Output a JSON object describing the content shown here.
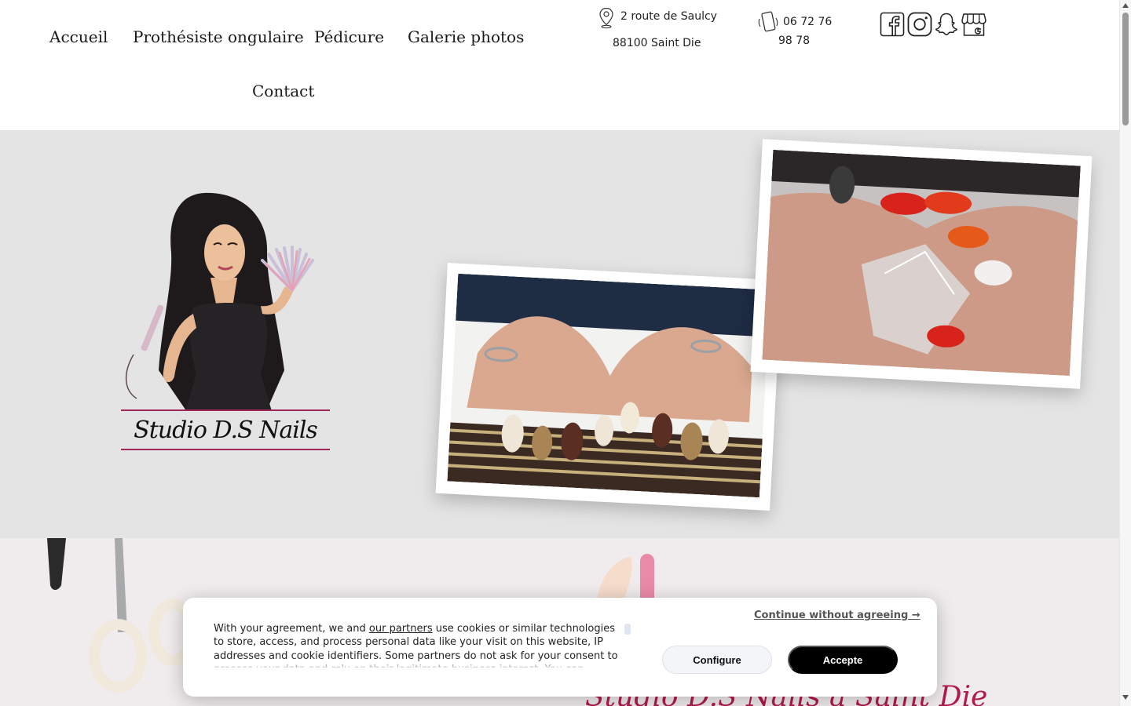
{
  "nav": {
    "items": [
      {
        "label": "Accueil"
      },
      {
        "label": "Prothésiste ongulaire"
      },
      {
        "label": "Pédicure"
      },
      {
        "label": "Galerie photos"
      },
      {
        "label": "Contact"
      }
    ]
  },
  "contact": {
    "address_line1": "2 route de Saulcy",
    "address_line2": "88100 Saint Die",
    "phone_line1": "06 72 76",
    "phone_line2": "98 78",
    "address_icon": "map-pin-icon",
    "phone_icon": "phone-icon"
  },
  "social": {
    "icons": [
      "facebook-icon",
      "instagram-icon",
      "snapchat-icon",
      "google-business-icon"
    ]
  },
  "hero": {
    "logo_text": "Studio D.S Nails",
    "background": "#e4e4e4"
  },
  "lower": {
    "title": "Studio D.S Nails à Saint Die"
  },
  "cookie": {
    "text_before_link": "With your agreement, we and ",
    "link_text": "our partners",
    "text_after_link": " use cookies or similar technologies to store, access, and process personal data like your visit on this website, IP addresses and cookie identifiers. Some partners do not ask for your consent to process your data and rely on their legitimate business interest. You can",
    "continue_label": "Continue without agreeing →",
    "configure_label": "Configure",
    "accept_label": "Accepte"
  },
  "colors": {
    "brand_accent": "#b21a4b",
    "accept_button": "#000000"
  }
}
